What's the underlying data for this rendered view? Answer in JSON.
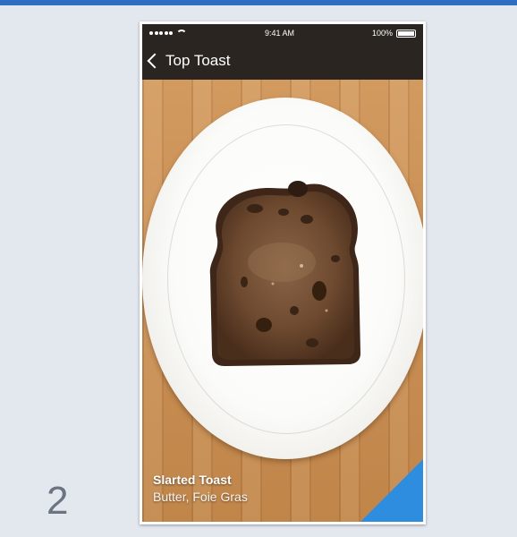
{
  "status_bar": {
    "time": "9:41 AM",
    "battery": "100%"
  },
  "nav": {
    "back_label": "Top Toast"
  },
  "caption": {
    "title": "Slarted Toast",
    "subtitle": "Butter, Foie Gras"
  },
  "step_number": "2",
  "colors": {
    "accent": "#2f6fc3",
    "corner_flag": "#2f8de0",
    "nav_background": "#2a2520",
    "page_background": "#e3e7ee"
  },
  "icons": [
    "signal-dots-icon",
    "wifi-icon",
    "battery-icon",
    "back-chevron-icon"
  ]
}
